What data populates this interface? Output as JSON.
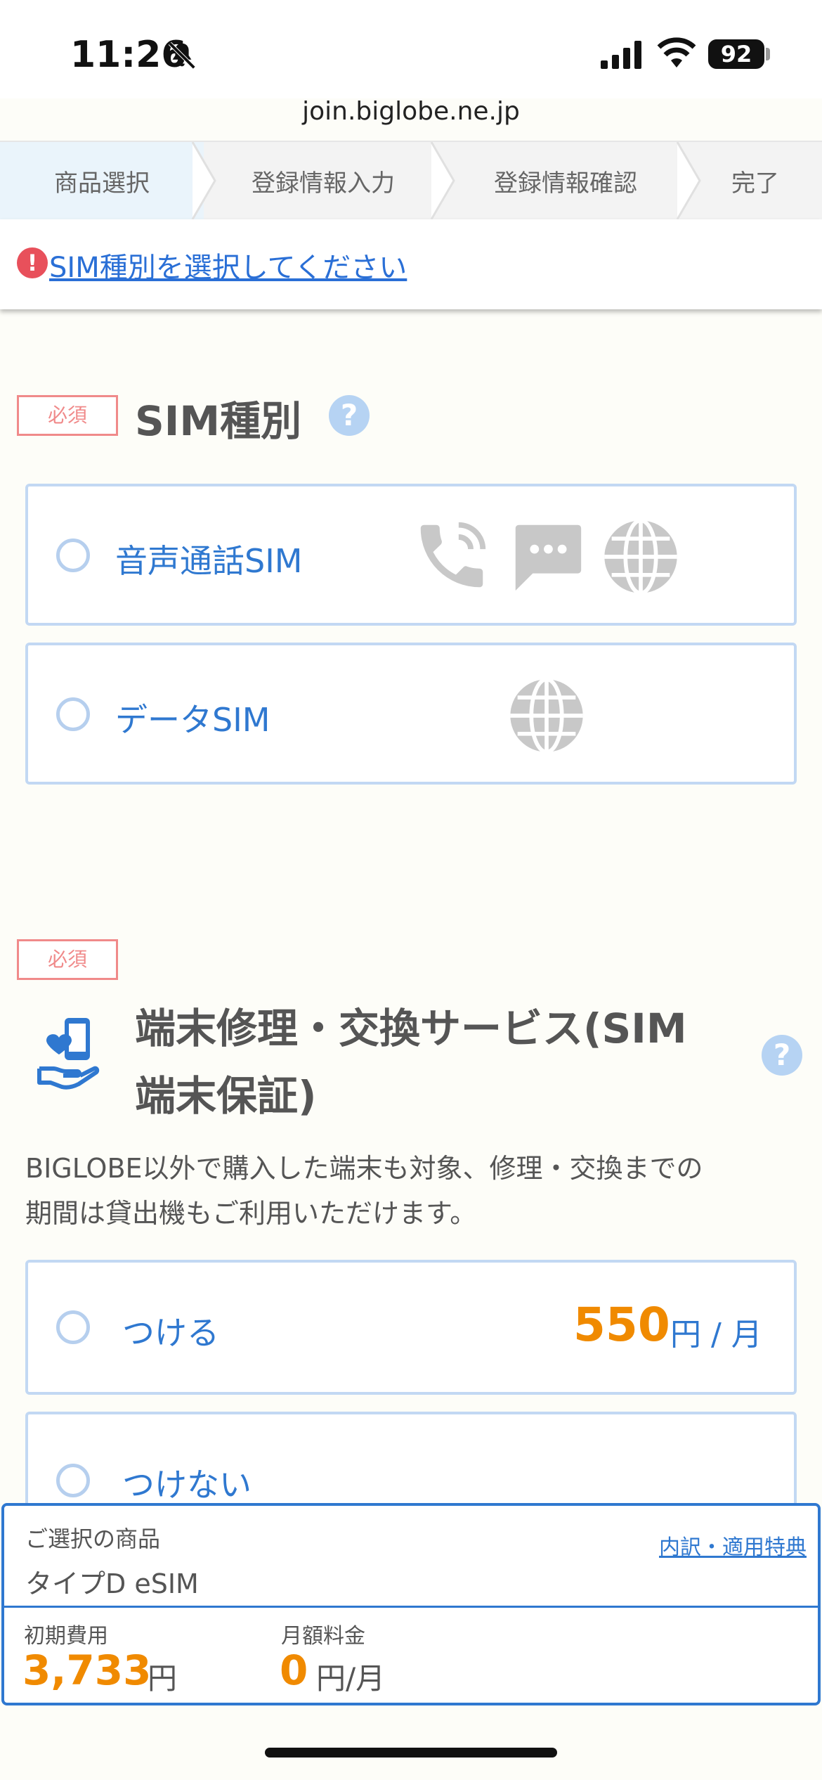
{
  "status_bar": {
    "time": "11:26",
    "battery": "92"
  },
  "browser": {
    "url": "join.biglobe.ne.jp"
  },
  "steps": [
    "商品選択",
    "登録情報入力",
    "登録情報確認",
    "完了"
  ],
  "error": {
    "message": "SIM種別を選択してください"
  },
  "sim_section": {
    "required_badge": "必須",
    "title": "SIM種別",
    "help_glyph": "?",
    "options": [
      {
        "label": "音声通話SIM",
        "icons": [
          "phone-icon",
          "sms-icon",
          "globe-icon"
        ]
      },
      {
        "label": "データSIM",
        "icons": [
          "globe-icon"
        ]
      }
    ]
  },
  "device_section": {
    "required_badge": "必須",
    "title_line1": "端末修理・交換サービス(SIM",
    "title_line2": "端末保証)",
    "help_glyph": "?",
    "description_line1": "BIGLOBE以外で購入した端末も対象、修理・交換までの",
    "description_line2": "期間は貸出機もご利用いただけます。",
    "options": [
      {
        "label": "つける",
        "price": "550",
        "price_unit": "円 / 月"
      },
      {
        "label": "つけない"
      }
    ]
  },
  "summary": {
    "selected_label": "ご選択の商品",
    "selected_product": "タイプD eSIM",
    "details_link": "内訳・適用特典",
    "initial_label": "初期費用",
    "initial_value": "3,733",
    "initial_unit": "円",
    "monthly_label": "月額料金",
    "monthly_value": "0",
    "monthly_unit": "円/月"
  },
  "colors": {
    "accent": "#2f78d0",
    "price": "#f08a00",
    "error": "#e8505b",
    "required": "#f08a8a"
  }
}
